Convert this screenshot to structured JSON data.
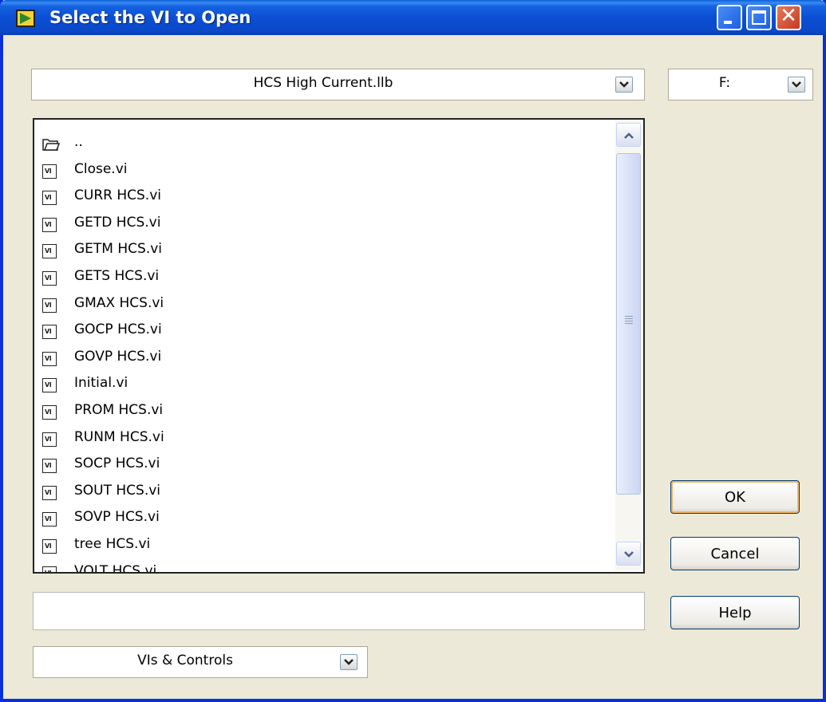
{
  "window": {
    "title": "Select the VI to Open"
  },
  "path_combo": {
    "value": "HCS High Current.llb"
  },
  "drive_combo": {
    "value": "F:"
  },
  "file_list": {
    "items": [
      {
        "label": "..",
        "icon": "folder-icon"
      },
      {
        "label": "Close.vi",
        "icon": "vi-file-icon"
      },
      {
        "label": "CURR HCS.vi",
        "icon": "vi-file-icon"
      },
      {
        "label": "GETD HCS.vi",
        "icon": "vi-file-icon"
      },
      {
        "label": "GETM HCS.vi",
        "icon": "vi-file-icon"
      },
      {
        "label": "GETS HCS.vi",
        "icon": "vi-file-icon"
      },
      {
        "label": "GMAX HCS.vi",
        "icon": "vi-file-icon"
      },
      {
        "label": "GOCP HCS.vi",
        "icon": "vi-file-icon"
      },
      {
        "label": "GOVP HCS.vi",
        "icon": "vi-file-icon"
      },
      {
        "label": "Initial.vi",
        "icon": "vi-file-icon"
      },
      {
        "label": "PROM HCS.vi",
        "icon": "vi-file-icon"
      },
      {
        "label": "RUNM HCS.vi",
        "icon": "vi-file-icon"
      },
      {
        "label": "SOCP HCS.vi",
        "icon": "vi-file-icon"
      },
      {
        "label": "SOUT HCS.vi",
        "icon": "vi-file-icon"
      },
      {
        "label": "SOVP HCS.vi",
        "icon": "vi-file-icon"
      },
      {
        "label": "tree HCS.vi",
        "icon": "vi-file-icon"
      },
      {
        "label": "VOLT HCS.vi",
        "icon": "vi-file-icon"
      }
    ]
  },
  "filename_field": {
    "value": ""
  },
  "filter_combo": {
    "value": "VIs & Controls"
  },
  "buttons": {
    "ok": "OK",
    "cancel": "Cancel",
    "help": "Help"
  },
  "colors": {
    "titlebar": "#0b4fd4",
    "dialog_bg": "#ece9d8",
    "close_button": "#c33b1f",
    "default_button_ring": "#f8b560"
  }
}
